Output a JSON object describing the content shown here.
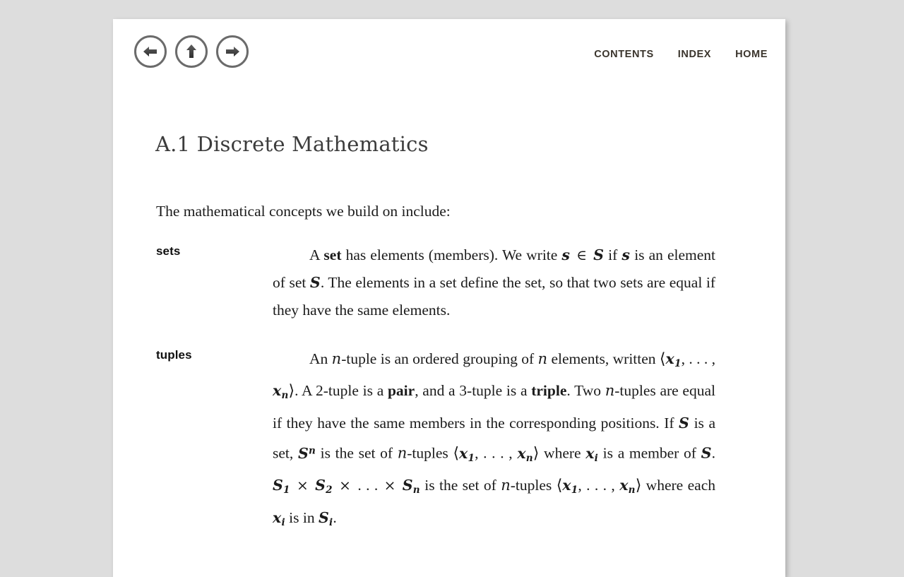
{
  "theme": {
    "page_background": "#dddddd",
    "sheet_background": "#ffffff",
    "nav_link_color": "#3a342c",
    "nav_button_ring_color": "#6b6b6b",
    "heading_color": "#3c3c3c",
    "body_text_color": "#1b1b1b"
  },
  "nav": {
    "buttons": [
      {
        "name": "back-button",
        "icon": "arrow-left-icon"
      },
      {
        "name": "up-button",
        "icon": "arrow-up-icon"
      },
      {
        "name": "forward-button",
        "icon": "arrow-right-icon"
      }
    ],
    "links": [
      {
        "label": "CONTENTS"
      },
      {
        "label": "INDEX"
      },
      {
        "label": "HOME"
      }
    ]
  },
  "document": {
    "section_title": "A.1 Discrete Mathematics",
    "intro": "The mathematical concepts we build on include:",
    "definitions": [
      {
        "label": "sets",
        "text_plain": "A set has elements (members). We write s ∈ S if s is an element of set S. The elements in a set define the set, so that two sets are equal if they have the same elements.",
        "parts": [
          {
            "t": "text",
            "v": "A "
          },
          {
            "t": "bold",
            "v": "set"
          },
          {
            "t": "text",
            "v": " has elements (members). We write "
          },
          {
            "t": "math",
            "v": "s"
          },
          {
            "t": "op",
            "v": "∈"
          },
          {
            "t": "math",
            "v": "S"
          },
          {
            "t": "text",
            "v": " if "
          },
          {
            "t": "math",
            "v": "s"
          },
          {
            "t": "text",
            "v": " is an element of set "
          },
          {
            "t": "math",
            "v": "S"
          },
          {
            "t": "text",
            "v": ". The elements in a set define the set, so that two sets are equal if they have the same elements."
          }
        ]
      },
      {
        "label": "tuples",
        "text_plain": "An n-tuple is an ordered grouping of n elements, written ⟨x1,...,xn⟩. A 2-tuple is a pair, and a 3-tuple is a triple. Two n-tuples are equal if they have the same members in the corresponding positions. If S is a set, S^n is the set of n-tuples ⟨x1,...,xn⟩ where xi is a member of S. S1 × S2 × ... × Sn is the set of n-tuples ⟨x1,...,xn⟩ where each xi is in Si.",
        "parts": [
          {
            "t": "text",
            "v": "An "
          },
          {
            "t": "math-light",
            "v": "n"
          },
          {
            "t": "text",
            "v": "-tuple is an ordered grouping of "
          },
          {
            "t": "math-light",
            "v": "n"
          },
          {
            "t": "text",
            "v": " elements, written "
          },
          {
            "t": "angle",
            "v": "⟨"
          },
          {
            "t": "math-sub",
            "base": "x",
            "sub": "1"
          },
          {
            "t": "text",
            "v": ", . . . , "
          },
          {
            "t": "math-sub",
            "base": "x",
            "sub": "n"
          },
          {
            "t": "angle",
            "v": "⟩"
          },
          {
            "t": "text",
            "v": ". A 2-tuple is a "
          },
          {
            "t": "bold",
            "v": "pair"
          },
          {
            "t": "text",
            "v": ", and a 3-tuple is a "
          },
          {
            "t": "bold",
            "v": "triple"
          },
          {
            "t": "text",
            "v": ". Two "
          },
          {
            "t": "math-light",
            "v": "n"
          },
          {
            "t": "text",
            "v": "-tuples are equal if they have the same members in the corresponding positions. If "
          },
          {
            "t": "math",
            "v": "S"
          },
          {
            "t": "text",
            "v": " is a set, "
          },
          {
            "t": "math-sup",
            "base": "S",
            "sup": "n"
          },
          {
            "t": "text",
            "v": " is the set of "
          },
          {
            "t": "math-light",
            "v": "n"
          },
          {
            "t": "text",
            "v": "-tuples "
          },
          {
            "t": "angle",
            "v": "⟨"
          },
          {
            "t": "math-sub",
            "base": "x",
            "sub": "1"
          },
          {
            "t": "text",
            "v": ", . . . , "
          },
          {
            "t": "math-sub",
            "base": "x",
            "sub": "n"
          },
          {
            "t": "angle",
            "v": "⟩"
          },
          {
            "t": "text",
            "v": " where "
          },
          {
            "t": "math-sub",
            "base": "x",
            "sub": "i"
          },
          {
            "t": "text",
            "v": " is a member of "
          },
          {
            "t": "math",
            "v": "S"
          },
          {
            "t": "text",
            "v": ". "
          },
          {
            "t": "math-sub",
            "base": "S",
            "sub": "1"
          },
          {
            "t": "op",
            "v": "×"
          },
          {
            "t": "math-sub",
            "base": "S",
            "sub": "2"
          },
          {
            "t": "op",
            "v": "×"
          },
          {
            "t": "text",
            "v": ". . . "
          },
          {
            "t": "op",
            "v": "×"
          },
          {
            "t": "math-sub",
            "base": "S",
            "sub": "n"
          },
          {
            "t": "text",
            "v": " is the set of "
          },
          {
            "t": "math-light",
            "v": "n"
          },
          {
            "t": "text",
            "v": "-tuples "
          },
          {
            "t": "angle",
            "v": "⟨"
          },
          {
            "t": "math-sub",
            "base": "x",
            "sub": "1"
          },
          {
            "t": "text",
            "v": ", . . . , "
          },
          {
            "t": "math-sub",
            "base": "x",
            "sub": "n"
          },
          {
            "t": "angle",
            "v": "⟩"
          },
          {
            "t": "text",
            "v": " where each "
          },
          {
            "t": "math-sub",
            "base": "x",
            "sub": "i"
          },
          {
            "t": "text",
            "v": " is in "
          },
          {
            "t": "math-sub",
            "base": "S",
            "sub": "i"
          },
          {
            "t": "text",
            "v": "."
          }
        ]
      }
    ]
  }
}
